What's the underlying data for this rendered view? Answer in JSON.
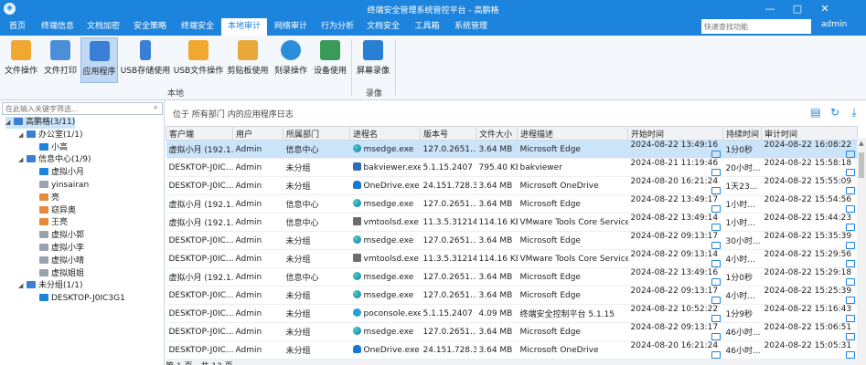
{
  "window": {
    "title": "终端安全管理系统管控平台 - 高鹏格",
    "minimize": "—",
    "restore": "□",
    "close": "✕"
  },
  "menu": [
    {
      "label": "首页"
    },
    {
      "label": "终端信息"
    },
    {
      "label": "文档加密"
    },
    {
      "label": "安全策略"
    },
    {
      "label": "终端安全"
    },
    {
      "label": "本地审计"
    },
    {
      "label": "网络审计"
    },
    {
      "label": "行为分析"
    },
    {
      "label": "文档安全"
    },
    {
      "label": "工具箱"
    },
    {
      "label": "系统管理"
    }
  ],
  "active_menu": "本地审计",
  "quick_search_placeholder": "快速查找功能",
  "user": "admin",
  "toolbar": {
    "tools": [
      {
        "label": "文件操作",
        "icon": "folder-file-icon",
        "color": "#f0a830"
      },
      {
        "label": "文件打印",
        "icon": "printer-icon",
        "color": "#4a8fd8"
      },
      {
        "label": "应用程序",
        "icon": "app-icon",
        "color": "#3a7fd5"
      },
      {
        "label": "USB存储使用",
        "icon": "usb-icon",
        "color": "#3a7fd5"
      },
      {
        "label": "USB文件操作",
        "icon": "usb-file-icon",
        "color": "#f0a830"
      },
      {
        "label": "剪贴板使用",
        "icon": "clipboard-icon",
        "color": "#e9a83a"
      },
      {
        "label": "刻录操作",
        "icon": "disc-icon",
        "color": "#2a8fd8"
      },
      {
        "label": "设备使用",
        "icon": "device-icon",
        "color": "#3a9a5a"
      },
      {
        "label": "屏幕录像",
        "icon": "screen-record-icon",
        "color": "#2a7fd5"
      }
    ],
    "groups": [
      {
        "label": "本地"
      },
      {
        "label": "录像"
      }
    ]
  },
  "tree": {
    "search_placeholder": "在此输入关键字筛选...",
    "nodes": [
      {
        "label": "高鹏格(3/11)",
        "toggle": "◢",
        "icon_color": "#3a7fd5"
      },
      {
        "label": "办公室(1/1)",
        "toggle": "◢",
        "icon_color": "#3a7fd5"
      },
      {
        "label": "小高",
        "toggle": "",
        "icon_color": "#1d84dd"
      },
      {
        "label": "信息中心(1/9)",
        "toggle": "◢",
        "icon_color": "#3a7fd5"
      },
      {
        "label": "虚拟小月",
        "toggle": "",
        "icon_color": "#1d84dd"
      },
      {
        "label": "yinsairan",
        "toggle": "",
        "icon_color": "#9aa3ad"
      },
      {
        "label": "亮",
        "toggle": "",
        "icon_color": "#e58a3a"
      },
      {
        "label": "窈异奥",
        "toggle": "",
        "icon_color": "#e58a3a"
      },
      {
        "label": "王亮",
        "toggle": "",
        "icon_color": "#e58a3a"
      },
      {
        "label": "虚拟小郭",
        "toggle": "",
        "icon_color": "#9aa3ad"
      },
      {
        "label": "虚拟小李",
        "toggle": "",
        "icon_color": "#9aa3ad"
      },
      {
        "label": "虚拟小晴",
        "toggle": "",
        "icon_color": "#9aa3ad"
      },
      {
        "label": "虚拟姐姐",
        "toggle": "",
        "icon_color": "#9aa3ad"
      },
      {
        "label": "未分组(1/1)",
        "toggle": "◢",
        "icon_color": "#3a7fd5"
      },
      {
        "label": "DESKTOP-J0IC3G1",
        "toggle": "",
        "icon_color": "#1d84dd"
      }
    ]
  },
  "breadcrumb": "位于 所有部门 内的应用程序日志",
  "table": {
    "columns": [
      "客户端",
      "用户",
      "所属部门",
      "进程名",
      "版本号",
      "文件大小",
      "进程描述",
      "开始时间",
      "持续时间",
      "审计时间"
    ],
    "rows": [
      [
        "虚拟小月 (192.1...",
        "Admin",
        "信息中心",
        "msedge.exe",
        "127.0.2651....",
        "3.64 MB",
        "Microsoft Edge",
        "2024-08-22 13:49:16",
        "1分0秒",
        "2024-08-22 16:08:22"
      ],
      [
        "DESKTOP-J0IC...",
        "Admin",
        "未分组",
        "bakviewer.exe",
        "5.1.15.2407",
        "795.40 KB",
        "bakviewer",
        "2024-08-21 11:19:46",
        "20小时...",
        "2024-08-22 15:58:18"
      ],
      [
        "DESKTOP-J0IC...",
        "Admin",
        "未分组",
        "OneDrive.exe",
        "24.151.728.3",
        "3.64 MB",
        "Microsoft OneDrive",
        "2024-08-20 16:21:24",
        "1天23...",
        "2024-08-22 15:55:09"
      ],
      [
        "虚拟小月 (192.1...",
        "Admin",
        "信息中心",
        "msedge.exe",
        "127.0.2651....",
        "3.64 MB",
        "Microsoft Edge",
        "2024-08-22 13:49:17",
        "1小时...",
        "2024-08-22 15:54:56"
      ],
      [
        "虚拟小月 (192.1...",
        "Admin",
        "信息中心",
        "vmtoolsd.exe",
        "11.3.5.31214",
        "114.16 KB",
        "VMware Tools Core Service",
        "2024-08-22 13:49:14",
        "1小时...",
        "2024-08-22 15:44:23"
      ],
      [
        "DESKTOP-J0IC...",
        "Admin",
        "未分组",
        "msedge.exe",
        "127.0.2651....",
        "3.64 MB",
        "Microsoft Edge",
        "2024-08-22 09:13:17",
        "30小时...",
        "2024-08-22 15:35:39"
      ],
      [
        "DESKTOP-J0IC...",
        "Admin",
        "未分组",
        "vmtoolsd.exe",
        "11.3.5.31214",
        "114.16 KB",
        "VMware Tools Core Service",
        "2024-08-22 09:13:14",
        "4小时...",
        "2024-08-22 15:29:56"
      ],
      [
        "虚拟小月 (192.1...",
        "Admin",
        "信息中心",
        "msedge.exe",
        "127.0.2651....",
        "3.64 MB",
        "Microsoft Edge",
        "2024-08-22 13:49:16",
        "1分0秒",
        "2024-08-22 15:29:18"
      ],
      [
        "DESKTOP-J0IC...",
        "Admin",
        "未分组",
        "msedge.exe",
        "127.0.2651....",
        "3.64 MB",
        "Microsoft Edge",
        "2024-08-22 09:13:17",
        "4小时...",
        "2024-08-22 15:25:39"
      ],
      [
        "DESKTOP-J0IC...",
        "Admin",
        "未分组",
        "poconsole.exe",
        "5.1.15.2407",
        "4.09 MB",
        "终端安全控制平台 5.1.15",
        "2024-08-22 10:52:22",
        "1分9秒",
        "2024-08-22 15:16:43"
      ],
      [
        "DESKTOP-J0IC...",
        "Admin",
        "未分组",
        "msedge.exe",
        "127.0.2651....",
        "3.64 MB",
        "Microsoft Edge",
        "2024-08-22 09:13:17",
        "46小时...",
        "2024-08-22 15:06:51"
      ],
      [
        "DESKTOP-J0IC...",
        "Admin",
        "未分组",
        "OneDrive.exe",
        "24.151.728.3",
        "3.64 MB",
        "Microsoft OneDrive",
        "2024-08-20 16:21:24",
        "46小时...",
        "2024-08-22 15:05:31"
      ]
    ],
    "process_icons": [
      "edge",
      "bak",
      "od",
      "edge",
      "vm",
      "edge",
      "vm",
      "edge",
      "edge",
      "poc",
      "edge",
      "od"
    ]
  },
  "footer_text": "第 1 页，共 13 页"
}
